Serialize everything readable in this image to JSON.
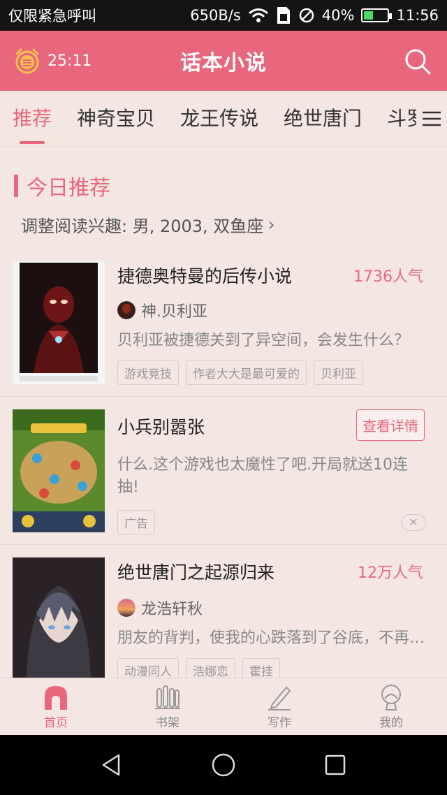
{
  "status_bar": {
    "carrier": "仅限紧急呼叫",
    "net_speed": "650B/s",
    "battery": "40%",
    "battery_level": 0.4,
    "time": "11:56"
  },
  "header": {
    "timer": "25:11",
    "title": "话本小说"
  },
  "tabs": [
    {
      "label": "推荐",
      "active": true
    },
    {
      "label": "神奇宝贝",
      "active": false
    },
    {
      "label": "龙王传说",
      "active": false
    },
    {
      "label": "绝世唐门",
      "active": false
    },
    {
      "label": "斗罗",
      "active": false
    }
  ],
  "section": {
    "title": "今日推荐",
    "prefs": "调整阅读兴趣: 男, 2003, 双鱼座"
  },
  "cards": [
    {
      "title": "捷德奥特曼的后传小说",
      "popularity": "1736人气",
      "author": "神.贝利亚",
      "summary": "贝利亚被捷德关到了异空间，会发生什么？",
      "tags": [
        "游戏竞技",
        "作者大大是最可爱的",
        "贝利亚"
      ]
    },
    {
      "title": "小兵别嚣张",
      "detail_button": "查看详情",
      "summary": "什么.这个游戏也太魔性了吧.开局就送10连抽!",
      "tags": [
        "广告"
      ],
      "close_icon": "✕"
    },
    {
      "title": "绝世唐门之起源归来",
      "popularity": "12万人气",
      "author": "龙浩轩秋",
      "summary": "朋友的背判，使我的心跌落到了谷底，不再相信任何人",
      "tags": [
        "动漫同人",
        "浩娜恋",
        "霍挂"
      ]
    }
  ],
  "bottom_nav": [
    {
      "label": "首页",
      "icon": "home-icon",
      "active": true
    },
    {
      "label": "书架",
      "icon": "bookshelf-icon",
      "active": false
    },
    {
      "label": "写作",
      "icon": "pen-icon",
      "active": false
    },
    {
      "label": "我的",
      "icon": "profile-icon",
      "active": false
    }
  ],
  "colors": {
    "accent": "#e8677d",
    "background": "#f3e6e3"
  }
}
